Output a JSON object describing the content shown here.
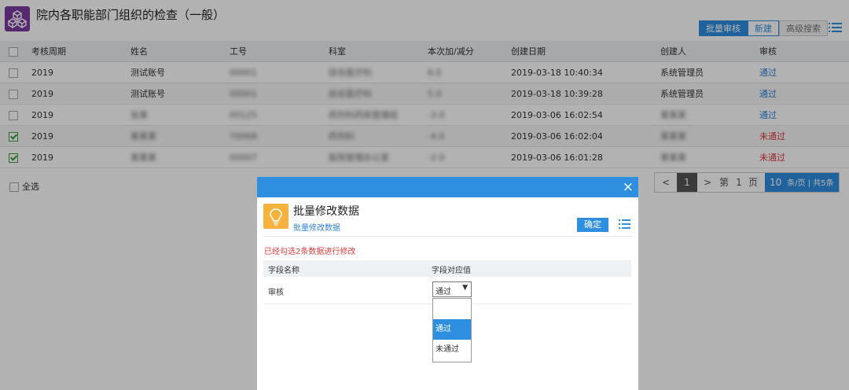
{
  "header": {
    "title": "院内各职能部门组织的检查（一般）",
    "batch_audit": "批量审核",
    "new": "新建",
    "advanced_search": "高级搜索"
  },
  "table": {
    "columns": [
      "考核周期",
      "姓名",
      "工号",
      "科室",
      "本次加/减分",
      "创建日期",
      "创建人",
      "审核"
    ],
    "rows": [
      {
        "checked": false,
        "period": "2019",
        "name": "测试账号",
        "id": "00001",
        "dept": "综合医疗科",
        "score": "6.0",
        "date": "2019-03-18 10:40:34",
        "creator": "系统管理员",
        "audit": "通过",
        "audit_pass": true
      },
      {
        "checked": false,
        "period": "2019",
        "name": "测试账号",
        "id": "00001",
        "dept": "综合医疗科",
        "score": "5.0",
        "date": "2019-03-18 10:39:28",
        "creator": "系统管理员",
        "audit": "通过",
        "audit_pass": true
      },
      {
        "checked": false,
        "period": "2019",
        "name": "张某",
        "id": "00125",
        "dept": "药剂科药库管理组",
        "score": "-3.0",
        "date": "2019-03-06 16:02:54",
        "creator": "某某某",
        "audit": "通过",
        "audit_pass": true
      },
      {
        "checked": true,
        "period": "2019",
        "name": "某某某",
        "id": "70068",
        "dept": "药剂科",
        "score": "-4.0",
        "date": "2019-03-06 16:02:04",
        "creator": "某某某",
        "audit": "未通过",
        "audit_pass": false
      },
      {
        "checked": true,
        "period": "2019",
        "name": "某某某",
        "id": "00007",
        "dept": "医院管理办公室",
        "score": "-2.0",
        "date": "2019-03-06 16:01:28",
        "creator": "某某某",
        "audit": "未通过",
        "audit_pass": false
      }
    ],
    "select_all": "全选"
  },
  "pager": {
    "prev": "<",
    "current": "1",
    "next": ">",
    "page_label_pre": "第",
    "page_no": "1",
    "page_label_post": "页",
    "page_size": "10",
    "size_suffix": "条/页 | 共5条"
  },
  "dialog": {
    "close": "×",
    "title": "批量修改数据",
    "subtitle": "批量修改数据",
    "confirm": "确定",
    "note": "已经勾选2条数据进行修改",
    "col_field": "字段名称",
    "col_value": "字段对应值",
    "field_label": "审核",
    "select_value": "通过",
    "options": [
      "",
      "通过",
      "未通过"
    ],
    "selected_option": "通过"
  },
  "colors": {
    "primary": "#2e8fe0",
    "logo": "#7b3aa0",
    "dialog_icon": "#f6b23c",
    "danger": "#e03a3a",
    "checkbox_on": "#3a9e3a"
  },
  "icons": [
    "cubes-logo-icon",
    "list-icon",
    "close-icon",
    "lightbulb-icon",
    "caret-down-icon",
    "checkbox-icon"
  ]
}
